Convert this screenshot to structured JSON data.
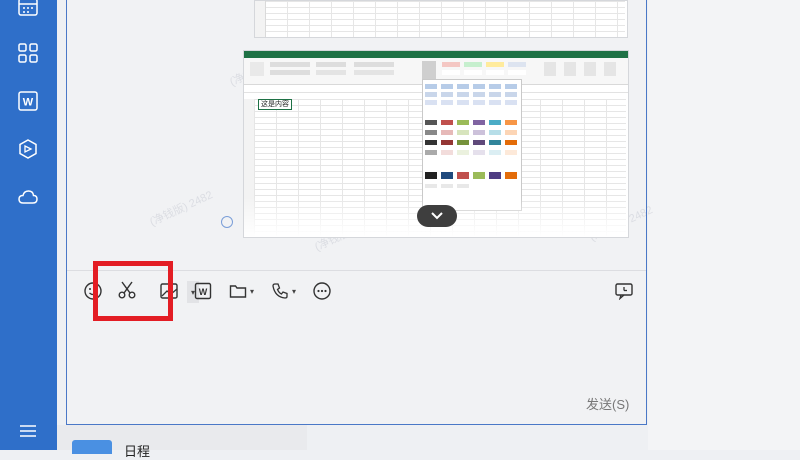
{
  "sidebar": {
    "items": [
      {
        "icon": "calendar-icon"
      },
      {
        "icon": "apps-grid-icon"
      },
      {
        "icon": "word-doc-icon",
        "label": "W"
      },
      {
        "icon": "cube-icon"
      },
      {
        "icon": "cloud-icon"
      }
    ],
    "menu_icon": "hamburger-menu-icon"
  },
  "message": {
    "spreadsheet_cell_text": "这是内容"
  },
  "watermark_text": "(净钱版) 2482",
  "toolbar": {
    "items": [
      {
        "icon": "emoji-icon"
      },
      {
        "icon": "scissors-icon",
        "has_dropdown": true
      },
      {
        "icon": "image-icon"
      },
      {
        "icon": "word-doc-icon",
        "label": "W"
      },
      {
        "icon": "folder-icon",
        "has_dropdown": true
      },
      {
        "icon": "phone-icon",
        "has_dropdown": true
      },
      {
        "icon": "more-icon"
      },
      {
        "icon": "chat-history-icon"
      }
    ],
    "dropdown_glyph": "▾"
  },
  "send_label": "发送(S)",
  "bottom_list": {
    "label": "日程"
  },
  "colors": {
    "sidebar": "#2f6fc9",
    "highlight": "#e31d24",
    "excel_green": "#1e7145"
  }
}
